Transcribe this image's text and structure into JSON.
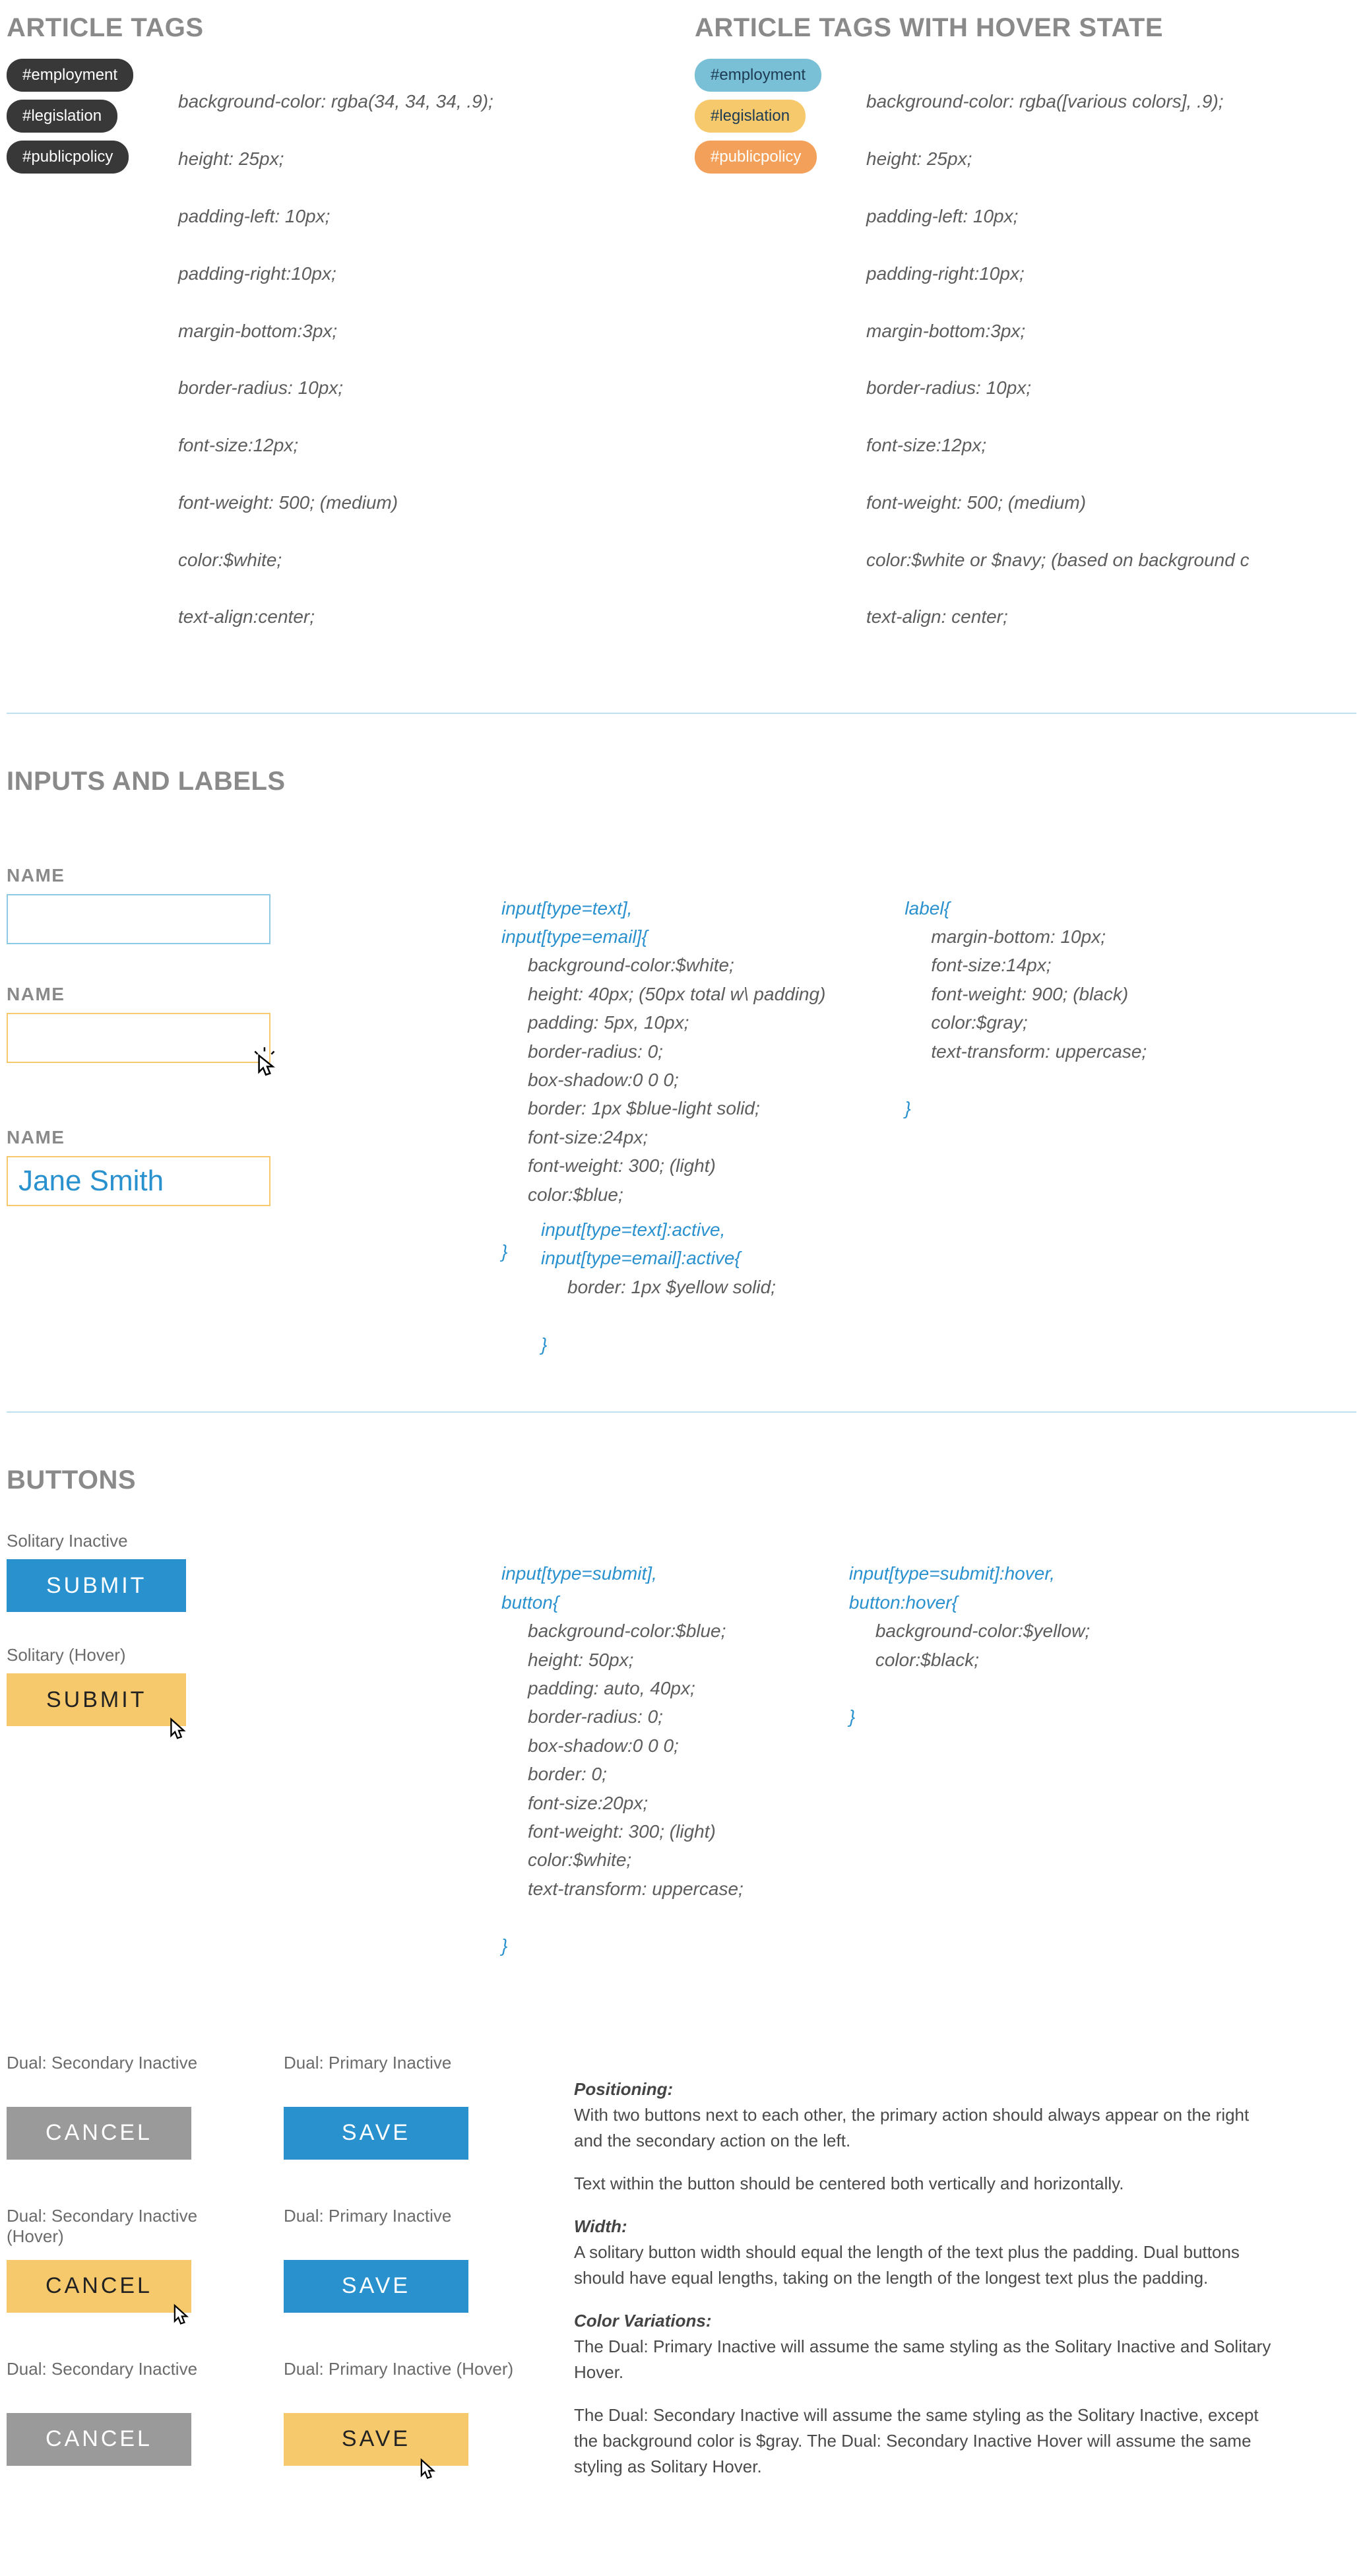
{
  "sections": {
    "tags": {
      "heading_left": "Article Tags",
      "heading_right": "Article Tags with Hover State",
      "tags": [
        "#employment",
        "#legislation",
        "#publicpolicy"
      ],
      "css_left": [
        "background-color: rgba(34, 34, 34, .9);",
        "height: 25px;",
        "padding-left: 10px;",
        "padding-right:10px;",
        "margin-bottom:3px;",
        "border-radius: 10px;",
        "font-size:12px;",
        "font-weight: 500; (medium)",
        "color:$white;",
        "text-align:center;"
      ],
      "css_right": [
        "background-color: rgba([various colors], .9);",
        "height: 25px;",
        "padding-left: 10px;",
        "padding-right:10px;",
        "margin-bottom:3px;",
        "border-radius: 10px;",
        "font-size:12px;",
        "font-weight: 500; (medium)",
        "color:$white or $navy; (based on background c",
        "text-align: center;"
      ]
    },
    "inputs": {
      "heading": "Inputs and Labels",
      "label": "Name",
      "value": "Jane Smith",
      "input_css": {
        "selector": "input[type=text],\ninput[type=email]{",
        "body": "background-color:$white;\nheight: 40px; (50px total w\\ padding)\npadding: 5px, 10px;\nborder-radius: 0;\nbox-shadow:0 0 0;\nborder: 1px $blue-light solid;\nfont-size:24px;\nfont-weight: 300; (light)\ncolor:$blue;",
        "close": "}"
      },
      "label_css": {
        "selector": "label{",
        "body": "margin-bottom: 10px;\nfont-size:14px;\nfont-weight: 900; (black)\ncolor:$gray;\ntext-transform: uppercase;",
        "close": "}"
      },
      "active_css": {
        "selector": "input[type=text]:active,\ninput[type=email]:active{",
        "body": "border: 1px $yellow solid;",
        "close": "}"
      }
    },
    "buttons": {
      "heading": "Buttons",
      "solitary_inactive_label": "Solitary Inactive",
      "solitary_hover_label": "Solitary (Hover)",
      "submit_text": "Submit",
      "button_css": {
        "selector": "input[type=submit],\nbutton{",
        "body": "background-color:$blue;\nheight: 50px;\npadding: auto, 40px;\nborder-radius: 0;\nbox-shadow:0 0 0;\nborder: 0;\nfont-size:20px;\nfont-weight: 300; (light)\ncolor:$white;\ntext-transform: uppercase;",
        "close": "}"
      },
      "button_hover_css": {
        "selector": "input[type=submit]:hover,\nbutton:hover{",
        "body": "background-color:$yellow;\ncolor:$black;",
        "close": "}"
      },
      "dual": {
        "sec_inactive": "Dual: Secondary Inactive",
        "pri_inactive": "Dual: Primary Inactive",
        "sec_hover": "Dual: Secondary Inactive (Hover)",
        "pri_hover": "Dual: Primary Inactive (Hover)",
        "cancel": "Cancel",
        "save": "Save"
      },
      "prose": {
        "positioning_h": "Positioning:",
        "positioning": "With two buttons next to each other, the primary action should always appear on the right and the secondary action on the left.",
        "positioning2": "Text within the button should be centered both vertically and horizontally.",
        "width_h": "Width:",
        "width": "A solitary button width should equal the length of the text plus the padding. Dual buttons should have equal lengths, taking on the length of the longest text plus the padding.",
        "color_h": "Color Variations:",
        "color1": "The Dual: Primary Inactive will assume the same styling as the Solitary Inactive and Solitary Hover.",
        "color2": "The Dual: Secondary Inactive will assume the same styling as the Solitary Inactive, except the background color is $gray. The Dual: Secondary Inactive Hover will assume the same styling as Solitary Hover."
      }
    }
  }
}
